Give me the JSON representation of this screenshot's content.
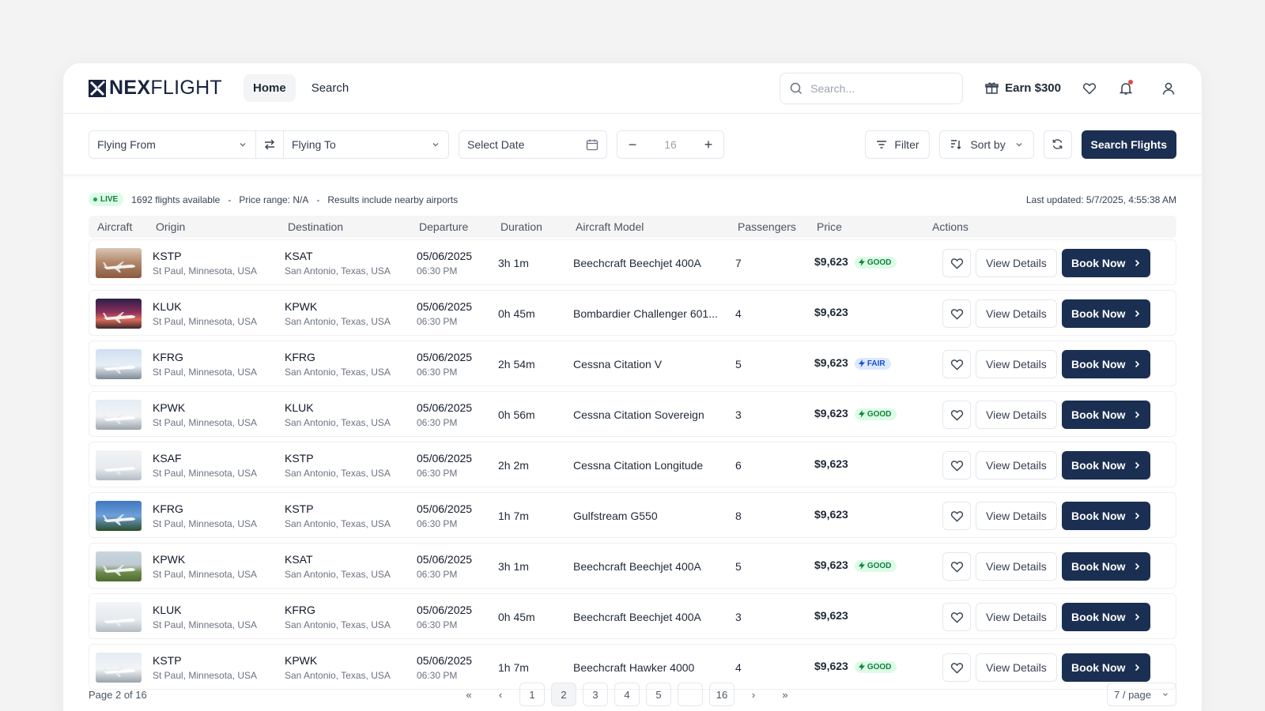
{
  "brand": {
    "bold": "NEX",
    "light": "FLIGHT"
  },
  "nav": [
    {
      "label": "Home"
    },
    {
      "label": "Search"
    }
  ],
  "search": {
    "placeholder": "Search..."
  },
  "header": {
    "earn_label": "Earn $300"
  },
  "filters": {
    "from_placeholder": "Flying From",
    "to_placeholder": "Flying To",
    "date_placeholder": "Select Date",
    "passengers_value": "16",
    "filter_label": "Filter",
    "sort_label": "Sort by",
    "search_button": "Search Flights"
  },
  "status": {
    "live_label": "LIVE",
    "available": "1692 flights available",
    "price_range": "Price range: N/A",
    "nearby": "Results include nearby airports",
    "last_updated": "Last updated: 5/7/2025, 4:55:38 AM",
    "separator": "-"
  },
  "columns": [
    "Aircraft",
    "Origin",
    "Destination",
    "Departure",
    "Duration",
    "Aircraft Model",
    "Passengers",
    "Price",
    "Actions"
  ],
  "actions": {
    "view_label": "View Details",
    "book_label": "Book Now"
  },
  "rows": [
    {
      "origin_code": "KSTP",
      "origin_city": "St Paul, Minnesota, USA",
      "dest_code": "KSAT",
      "dest_city": "San Antonio, Texas, USA",
      "date": "05/06/2025",
      "time": "06:30 PM",
      "duration": "3h 1m",
      "model": "Beechcraft Beechjet 400A",
      "passengers": "7",
      "price": "$9,623",
      "badge": "GOOD",
      "thumb": "interior"
    },
    {
      "origin_code": "KLUK",
      "origin_city": "St Paul, Minnesota, USA",
      "dest_code": "KPWK",
      "dest_city": "San Antonio, Texas, USA",
      "date": "05/06/2025",
      "time": "06:30 PM",
      "duration": "0h 45m",
      "model": "Bombardier Challenger 601...",
      "passengers": "4",
      "price": "$9,623",
      "badge": "",
      "thumb": "sunset"
    },
    {
      "origin_code": "KFRG",
      "origin_city": "St Paul, Minnesota, USA",
      "dest_code": "KFRG",
      "dest_city": "San Antonio, Texas, USA",
      "date": "05/06/2025",
      "time": "06:30 PM",
      "duration": "2h 54m",
      "model": "Cessna Citation V",
      "passengers": "5",
      "price": "$9,623",
      "badge": "FAIR",
      "thumb": "sky"
    },
    {
      "origin_code": "KPWK",
      "origin_city": "St Paul, Minnesota, USA",
      "dest_code": "KLUK",
      "dest_city": "San Antonio, Texas, USA",
      "date": "05/06/2025",
      "time": "06:30 PM",
      "duration": "0h 56m",
      "model": "Cessna Citation Sovereign",
      "passengers": "3",
      "price": "$9,623",
      "badge": "GOOD",
      "thumb": "pale"
    },
    {
      "origin_code": "KSAF",
      "origin_city": "St Paul, Minnesota, USA",
      "dest_code": "KSTP",
      "dest_city": "San Antonio, Texas, USA",
      "date": "05/06/2025",
      "time": "06:30 PM",
      "duration": "2h 2m",
      "model": "Cessna Citation Longitude",
      "passengers": "6",
      "price": "$9,623",
      "badge": "",
      "thumb": "white"
    },
    {
      "origin_code": "KFRG",
      "origin_city": "St Paul, Minnesota, USA",
      "dest_code": "KSTP",
      "dest_city": "San Antonio, Texas, USA",
      "date": "05/06/2025",
      "time": "06:30 PM",
      "duration": "1h 7m",
      "model": "Gulfstream G550",
      "passengers": "8",
      "price": "$9,623",
      "badge": "",
      "thumb": "blue"
    },
    {
      "origin_code": "KPWK",
      "origin_city": "St Paul, Minnesota, USA",
      "dest_code": "KSAT",
      "dest_city": "San Antonio, Texas, USA",
      "date": "05/06/2025",
      "time": "06:30 PM",
      "duration": "3h 1m",
      "model": "Beechcraft Beechjet 400A",
      "passengers": "5",
      "price": "$9,623",
      "badge": "GOOD",
      "thumb": "grass"
    },
    {
      "origin_code": "KLUK",
      "origin_city": "St Paul, Minnesota, USA",
      "dest_code": "KFRG",
      "dest_city": "San Antonio, Texas, USA",
      "date": "05/06/2025",
      "time": "06:30 PM",
      "duration": "0h 45m",
      "model": "Beechcraft Beechjet 400A",
      "passengers": "3",
      "price": "$9,623",
      "badge": "",
      "thumb": "white"
    },
    {
      "origin_code": "KSTP",
      "origin_city": "St Paul, Minnesota, USA",
      "dest_code": "KPWK",
      "dest_city": "San Antonio, Texas, USA",
      "date": "05/06/2025",
      "time": "06:30 PM",
      "duration": "1h 7m",
      "model": "Beechcraft Hawker 4000",
      "passengers": "4",
      "price": "$9,623",
      "badge": "GOOD",
      "thumb": "pale"
    }
  ],
  "pagination": {
    "label": "Page 2 of 16",
    "first": "«",
    "prev": "‹",
    "next": "›",
    "last": "»",
    "pages": [
      "1",
      "2",
      "3",
      "4",
      "5",
      "",
      "16"
    ],
    "per_page": "7 / page"
  },
  "colors": {
    "primary": "#1b2f52",
    "good": "#15803d",
    "fair": "#1d4ed8",
    "alert": "#ef4444"
  }
}
